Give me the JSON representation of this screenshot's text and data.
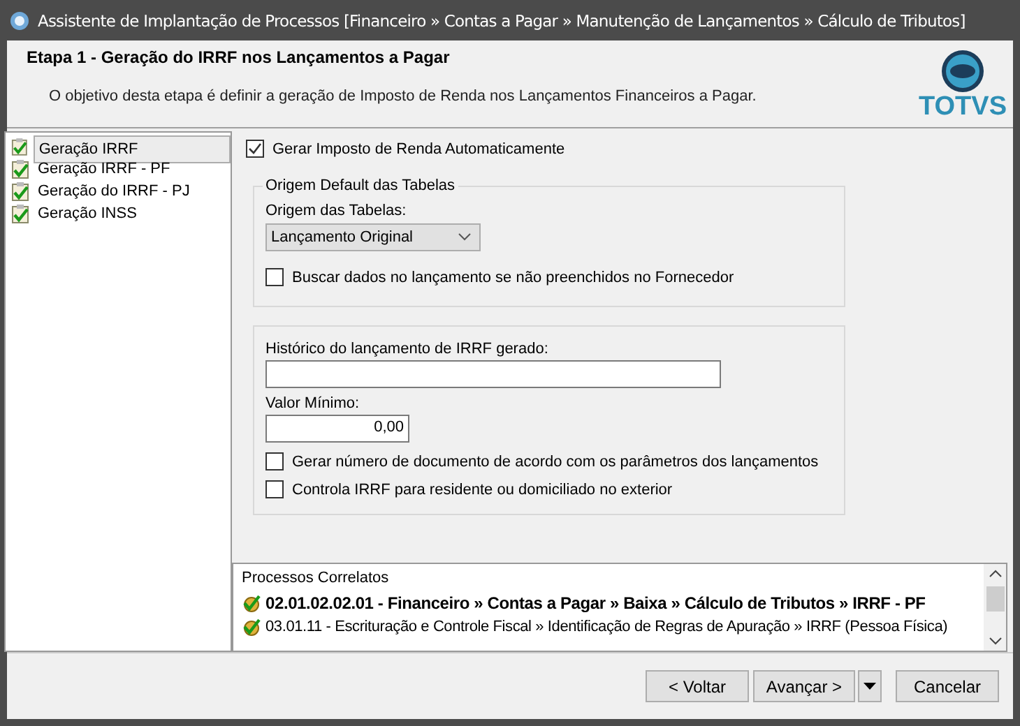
{
  "window": {
    "title": "Assistente de Implantação de Processos [Financeiro » Contas a Pagar » Manutenção de Lançamentos » Cálculo de Tributos]"
  },
  "header": {
    "title": "Etapa 1 - Geração do IRRF nos Lançamentos a Pagar",
    "description": "O objetivo desta etapa é definir a geração de Imposto de Renda nos Lançamentos Financeiros a Pagar.",
    "logo": "TOTVS"
  },
  "sidebar": {
    "items": [
      {
        "label": "Geração IRRF",
        "selected": true
      },
      {
        "label": "Geração IRRF - PF",
        "selected": false
      },
      {
        "label": "Geração do IRRF - PJ",
        "selected": false
      },
      {
        "label": "Geração INSS",
        "selected": false
      }
    ]
  },
  "form": {
    "auto_tax": {
      "label": "Gerar Imposto de Renda Automaticamente",
      "checked": true
    },
    "origin_group": {
      "title": "Origem Default das Tabelas",
      "select_label": "Origem das Tabelas:",
      "select_value": "Lançamento Original",
      "fetch": {
        "label": "Buscar dados no lançamento se não preenchidos no Fornecedor",
        "checked": false
      }
    },
    "history_label": "Histórico do lançamento de IRRF gerado:",
    "min_label": "Valor Mínimo:",
    "min_value": "0,00",
    "options": [
      {
        "label": "Gerar número de documento de acordo com os parâmetros dos lançamentos",
        "checked": false
      },
      {
        "label": "Controla IRRF para residente ou domiciliado no exterior",
        "checked": false
      }
    ]
  },
  "related": {
    "title": "Processos Correlatos",
    "items": [
      {
        "text": "02.01.02.02.01 - Financeiro » Contas a Pagar » Baixa » Cálculo de Tributos » IRRF - PF",
        "highlighted": true
      },
      {
        "text": "03.01.11 - Escrituração e Controle Fiscal » Identificação de Regras de Apuração » IRRF (Pessoa Física)",
        "highlighted": false
      }
    ]
  },
  "buttons": {
    "back": "< Voltar",
    "next": "Avançar >",
    "cancel": "Cancelar"
  }
}
